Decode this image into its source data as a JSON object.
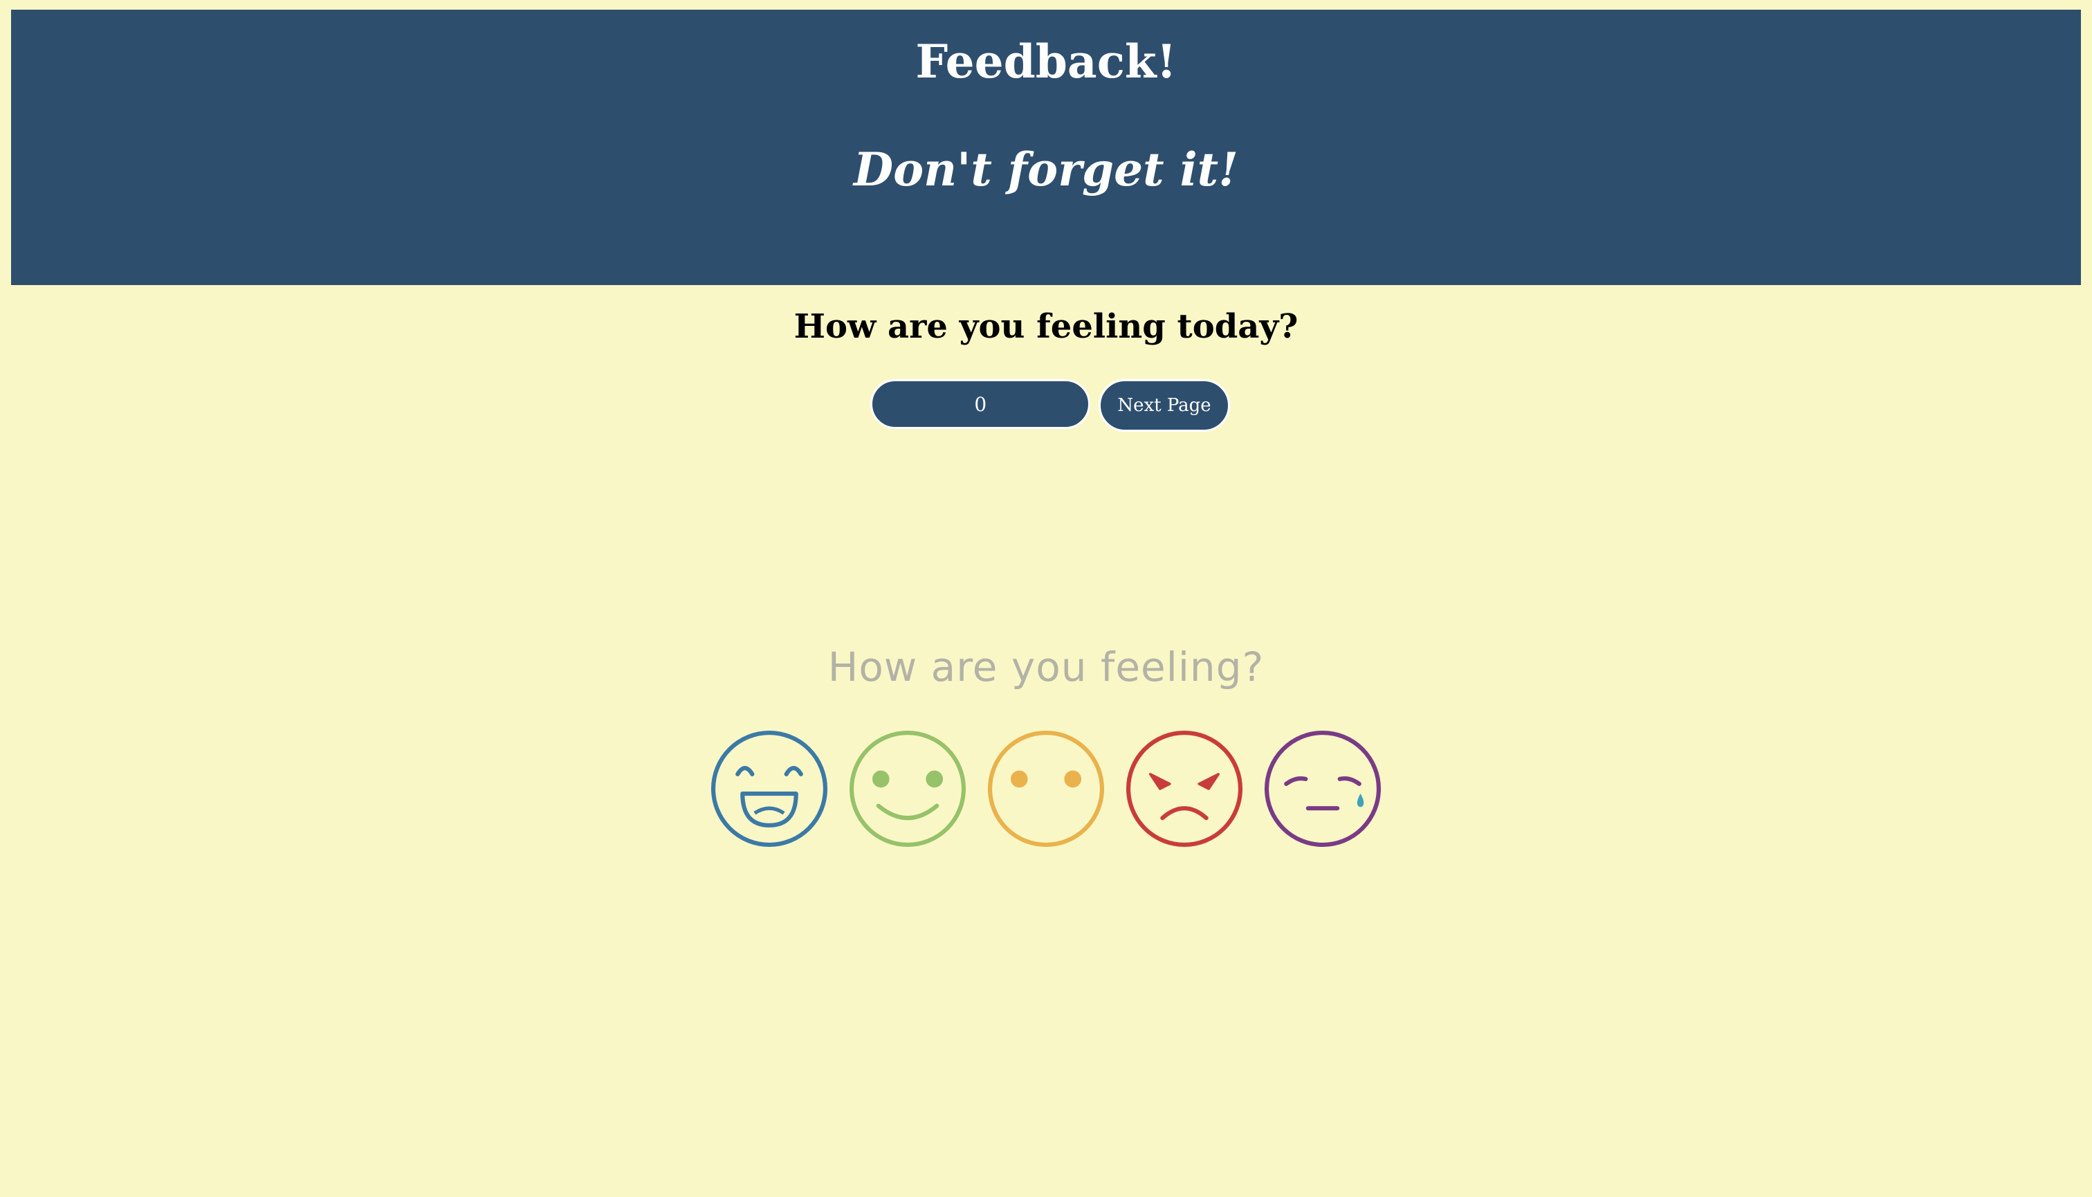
{
  "header": {
    "title": "Feedback!",
    "subtitle": "Don't forget it!"
  },
  "question": "How are you feeling today?",
  "form": {
    "input_value": "0",
    "next_button_label": "Next Page"
  },
  "feeling_graphic": {
    "caption": "How are you feeling?",
    "faces": [
      {
        "name": "laughing-face-icon",
        "color": "#3b7aa6"
      },
      {
        "name": "smiling-face-icon",
        "color": "#96c26a"
      },
      {
        "name": "neutral-face-icon",
        "color": "#e9b24c"
      },
      {
        "name": "angry-face-icon",
        "color": "#c93c3c"
      },
      {
        "name": "crying-face-icon",
        "color": "#7a3b86"
      }
    ]
  },
  "colors": {
    "background": "#faf7c6",
    "header_background": "#2e4e6e",
    "accent": "#2e4e6e"
  }
}
